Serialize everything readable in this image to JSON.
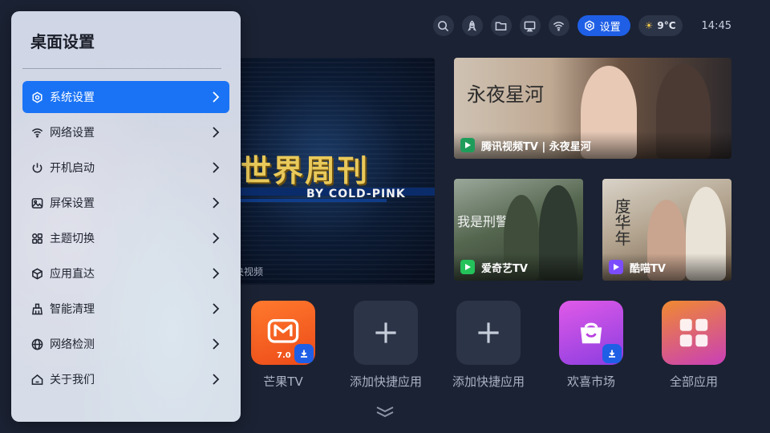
{
  "panel": {
    "title": "桌面设置",
    "items": [
      {
        "label": "系统设置",
        "icon": "hexagon-gear-icon",
        "active": true
      },
      {
        "label": "网络设置",
        "icon": "wifi-icon",
        "active": false
      },
      {
        "label": "开机启动",
        "icon": "power-icon",
        "active": false
      },
      {
        "label": "屏保设置",
        "icon": "image-icon",
        "active": false
      },
      {
        "label": "主题切换",
        "icon": "grid-icon",
        "active": false
      },
      {
        "label": "应用直达",
        "icon": "cube-icon",
        "active": false
      },
      {
        "label": "智能清理",
        "icon": "broom-icon",
        "active": false
      },
      {
        "label": "网络检测",
        "icon": "globe-icon",
        "active": false
      },
      {
        "label": "关于我们",
        "icon": "home-icon",
        "active": false
      }
    ]
  },
  "topbar": {
    "icons": [
      "search-icon",
      "rocket-icon",
      "folder-icon",
      "cast-icon",
      "wifi-icon"
    ],
    "settings_label": "设置",
    "weather": "9°C",
    "time": "14:45"
  },
  "hero": {
    "title": "世界周刊",
    "subtitle": "BY COLD-PINK",
    "source": "央视频"
  },
  "features": [
    {
      "calligraphy": "永夜星河",
      "caption": "腾讯视频TV | 永夜星河",
      "app_icon": "tencent-video-icon"
    },
    {
      "calligraphy": "我是刑警",
      "caption": "爱奇艺TV",
      "app_icon": "iqiyi-icon"
    },
    {
      "calligraphy": "度华年",
      "caption": "酷喵TV",
      "app_icon": "kumiao-icon"
    }
  ],
  "apps": [
    {
      "label": "芒果TV",
      "version": "7.0",
      "icon": "mango-tv-icon",
      "download": true
    },
    {
      "label": "添加快捷应用",
      "icon": "plus-icon",
      "download": false
    },
    {
      "label": "添加快捷应用",
      "icon": "plus-icon",
      "download": false
    },
    {
      "label": "欢喜市场",
      "icon": "shopping-bag-icon",
      "download": true
    },
    {
      "label": "全部应用",
      "icon": "app-grid-icon",
      "download": false
    }
  ],
  "colors": {
    "background": "#1b2233",
    "accent": "#1a73f5",
    "mango": "#f25a1e",
    "market": "#b83fe0",
    "all_apps": "#e9552f"
  }
}
